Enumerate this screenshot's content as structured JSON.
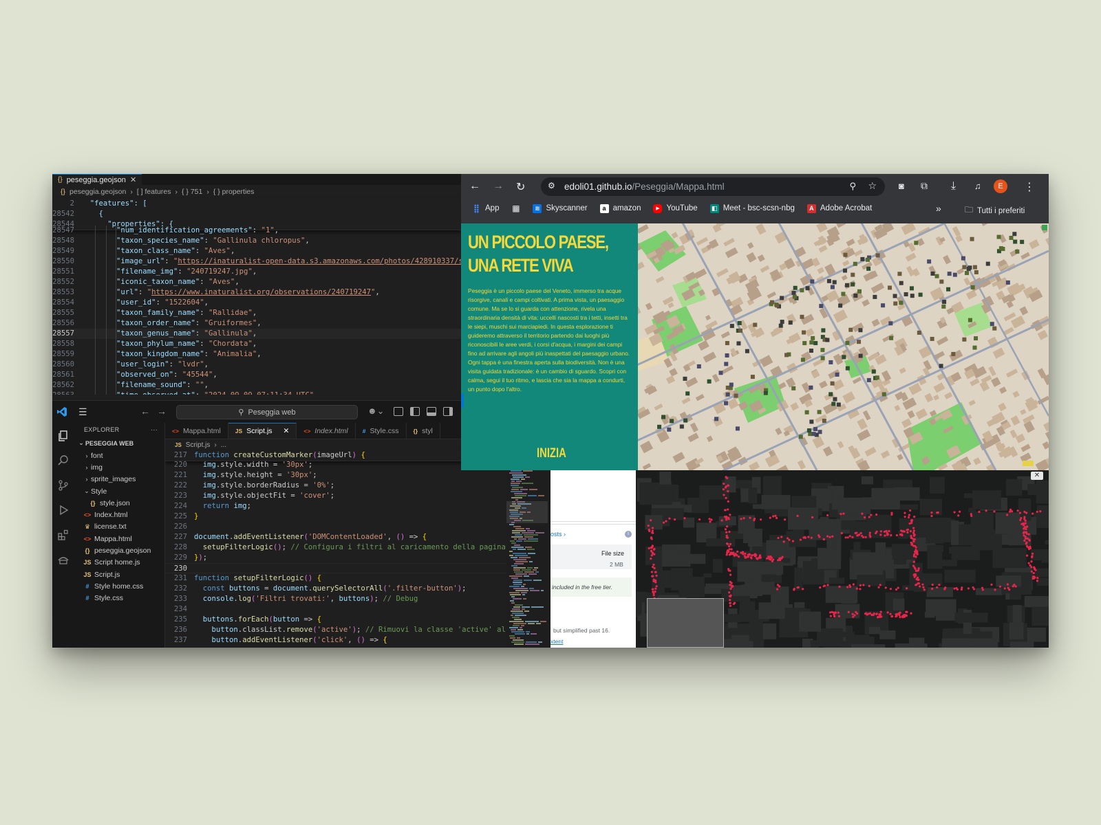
{
  "json_editor": {
    "tab_label": "peseggia.geojson",
    "breadcrumb": [
      "peseggia.geojson",
      "[ ] features",
      "{ } 751",
      "{ } properties"
    ],
    "sticky_lines": [
      {
        "ln": "2",
        "text": "  \"features\": ["
      },
      {
        "ln": "28542",
        "text": "    {"
      },
      {
        "ln": "28544",
        "text": "      \"properties\": {"
      }
    ],
    "lines": [
      {
        "ln": "28547",
        "key": "num_identification_agreements",
        "val": "1",
        "partial": true
      },
      {
        "ln": "28548",
        "key": "taxon_species_name",
        "val": "Gallinula chloropus"
      },
      {
        "ln": "28549",
        "key": "taxon_class_name",
        "val": "Aves"
      },
      {
        "ln": "28550",
        "key": "image_url",
        "val": "https://inaturalist-open-data.s3.amazonaws.com/photos/428910337/sm",
        "link": true
      },
      {
        "ln": "28551",
        "key": "filename_img",
        "val": "240719247.jpg"
      },
      {
        "ln": "28552",
        "key": "iconic_taxon_name",
        "val": "Aves"
      },
      {
        "ln": "28553",
        "key": "url",
        "val": "https://www.inaturalist.org/observations/240719247",
        "link": true
      },
      {
        "ln": "28554",
        "key": "user_id",
        "val": "1522604"
      },
      {
        "ln": "28555",
        "key": "taxon_family_name",
        "val": "Rallidae"
      },
      {
        "ln": "28556",
        "key": "taxon_order_name",
        "val": "Gruiformes"
      },
      {
        "ln": "28557",
        "key": "taxon_genus_name",
        "val": "Gallinula",
        "current": true
      },
      {
        "ln": "28558",
        "key": "taxon_phylum_name",
        "val": "Chordata"
      },
      {
        "ln": "28559",
        "key": "taxon_kingdom_name",
        "val": "Animalia"
      },
      {
        "ln": "28560",
        "key": "user_login",
        "val": "lvdr"
      },
      {
        "ln": "28561",
        "key": "observed_on",
        "val": "45544"
      },
      {
        "ln": "28562",
        "key": "filename_sound",
        "val": ""
      },
      {
        "ln": "28563",
        "key": "time_observed_at",
        "val": "2024-09-09 07:11:34 UTC"
      }
    ]
  },
  "vscode": {
    "command_center": "Peseggia web",
    "explorer_title": "EXPLORER",
    "explorer_more": "···",
    "root_folder": "PESEGGIA WEB",
    "tree": [
      {
        "label": "font",
        "type": "folder",
        "depth": 1,
        "open": false
      },
      {
        "label": "img",
        "type": "folder",
        "depth": 1,
        "open": false
      },
      {
        "label": "sprite_images",
        "type": "folder",
        "depth": 1,
        "open": false
      },
      {
        "label": "Style",
        "type": "folder",
        "depth": 1,
        "open": true
      },
      {
        "label": "style.json",
        "type": "json",
        "depth": 2
      },
      {
        "label": "Index.html",
        "type": "html",
        "depth": 1
      },
      {
        "label": "license.txt",
        "type": "txt",
        "depth": 1
      },
      {
        "label": "Mappa.html",
        "type": "html",
        "depth": 1
      },
      {
        "label": "peseggia.geojson",
        "type": "json",
        "depth": 1
      },
      {
        "label": "Script home.js",
        "type": "js",
        "depth": 1
      },
      {
        "label": "Script.js",
        "type": "js",
        "depth": 1
      },
      {
        "label": "Style home.css",
        "type": "css",
        "depth": 1
      },
      {
        "label": "Style.css",
        "type": "css",
        "depth": 1
      }
    ],
    "tabs": [
      {
        "label": "Mappa.html",
        "icon": "<>",
        "active": false,
        "italic": false
      },
      {
        "label": "Script.js",
        "icon": "JS",
        "active": true,
        "italic": false
      },
      {
        "label": "Index.html",
        "icon": "<>",
        "active": false,
        "italic": true
      },
      {
        "label": "Style.css",
        "icon": "#",
        "active": false,
        "italic": false
      },
      {
        "label": "styl",
        "icon": "{}",
        "active": false,
        "italic": false
      }
    ],
    "breadcrumb": [
      "Script.js",
      "..."
    ],
    "sticky_line": {
      "ln": "217",
      "text": "function createCustomMarker(imageUrl) {"
    },
    "code_lines": [
      {
        "ln": "220",
        "text": "  img.style.width = '30px';"
      },
      {
        "ln": "221",
        "text": "  img.style.height = '30px';"
      },
      {
        "ln": "222",
        "text": "  img.style.borderRadius = '0%';"
      },
      {
        "ln": "223",
        "text": "  img.style.objectFit = 'cover';"
      },
      {
        "ln": "224",
        "text": "  return img;"
      },
      {
        "ln": "225",
        "text": "}"
      },
      {
        "ln": "226",
        "text": ""
      },
      {
        "ln": "227",
        "text": "document.addEventListener('DOMContentLoaded', () => {"
      },
      {
        "ln": "228",
        "text": "  setupFilterLogic(); // Configura i filtri al caricamento della pagina"
      },
      {
        "ln": "229",
        "text": "});"
      },
      {
        "ln": "230",
        "text": "",
        "current": true
      },
      {
        "ln": "231",
        "text": "function setupFilterLogic() {"
      },
      {
        "ln": "232",
        "text": "  const buttons = document.querySelectorAll('.filter-button');"
      },
      {
        "ln": "233",
        "text": "  console.log('Filtri trovati:', buttons); // Debug"
      },
      {
        "ln": "234",
        "text": ""
      },
      {
        "ln": "235",
        "text": "  buttons.forEach(button => {"
      },
      {
        "ln": "236",
        "text": "    button.classList.remove('active'); // Rimuovi la classe 'active' al"
      },
      {
        "ln": "237",
        "text": "    button.addEventListener('click', () => {"
      }
    ]
  },
  "browser": {
    "url_host": "edoli01.github.io",
    "url_path": "/Peseggia/Mappa.html",
    "profile_initial": "E",
    "bookmarks": [
      {
        "label": "App",
        "icon": "apps-grid-icon",
        "color": "#4285f4"
      },
      {
        "label": "",
        "icon": "tab-groups-icon",
        "color": "#e8eaed"
      },
      {
        "label": "Skyscanner",
        "icon": "skyscanner-icon",
        "color": "#0770e3"
      },
      {
        "label": "amazon",
        "icon": "amazon-icon",
        "color": "#ffffff"
      },
      {
        "label": "YouTube",
        "icon": "youtube-icon",
        "color": "#ff0000"
      },
      {
        "label": "Meet - bsc-scsn-nbg",
        "icon": "meet-icon",
        "color": "#00897b"
      },
      {
        "label": "Adobe Acrobat",
        "icon": "acrobat-icon",
        "color": "#d32f2f"
      }
    ],
    "more_bookmarks": "»",
    "all_bookmarks": "Tutti i preferiti"
  },
  "site": {
    "title": "UN PICCOLO PAESE, UNA RETE VIVA",
    "body": "Peseggia è un piccolo paese del Veneto, immerso tra acque risorgive, canali e campi coltivati. A prima vista, un paesaggio comune. Ma se lo si guarda con attenzione, rivela una straordinaria densità di vita: uccelli nascosti tra i tetti, insetti tra le siepi, muschi sui marciapiedi. In questa esplorazione ti guideremo attraverso il territorio partendo dai luoghi più riconoscibili le aree verdi, i corsi d'acqua, i margini dei campi fino ad arrivare agli angoli più inaspettati del paesaggio urbano. Ogni tappa è una finestra aperta sulla biodiversità. Non è una visita guidata tradizionale: è un cambio di sguardo. Scopri con calma, segui il tuo ritmo, e lascia che sia la mappa a condurti, un punto dopo l'altro.",
    "button": "INIZIA",
    "accent": "#f5d83a",
    "panel_color": "#12887a"
  },
  "behind_window": {
    "link_text": "osts",
    "file_size_label": "File size",
    "file_size_value": "2 MB",
    "free_tier": "included in the free tier.",
    "simplified": "but simplified past 16.",
    "extent": "xtent"
  }
}
